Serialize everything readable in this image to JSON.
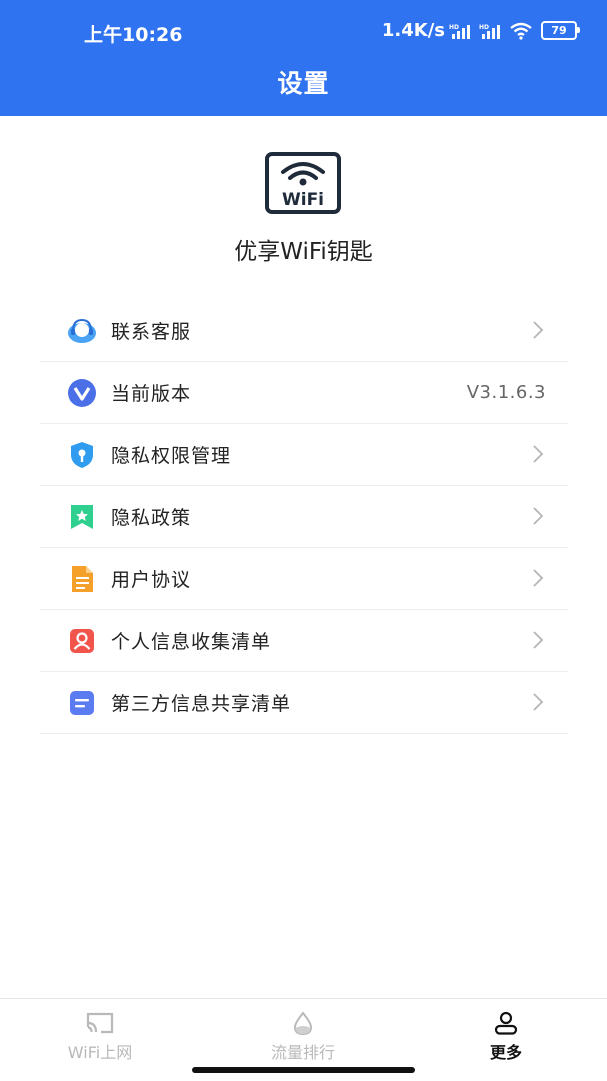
{
  "status_bar": {
    "time": "上午10:26",
    "network_speed": "1.4K/s",
    "battery": "79"
  },
  "header": {
    "title": "设置"
  },
  "app": {
    "name": "优享WiFi钥匙",
    "logo_text": "WiFi"
  },
  "menu": {
    "items": [
      {
        "label": "联系客服",
        "icon": "customer-service-icon",
        "color": "#4aa3f5"
      },
      {
        "label": "当前版本",
        "icon": "version-icon",
        "value": "V3.1.6.3",
        "color": "#4a6fe6"
      },
      {
        "label": "隐私权限管理",
        "icon": "shield-icon",
        "color": "#2f9cf0"
      },
      {
        "label": "隐私政策",
        "icon": "bookmark-icon",
        "color": "#2fcf8f"
      },
      {
        "label": "用户协议",
        "icon": "document-icon",
        "color": "#f5a02a"
      },
      {
        "label": "个人信息收集清单",
        "icon": "user-card-icon",
        "color": "#f0544a"
      },
      {
        "label": "第三方信息共享清单",
        "icon": "list-doc-icon",
        "color": "#5b7cf0"
      }
    ]
  },
  "tabbar": {
    "tabs": [
      {
        "label": "WiFi上网",
        "icon": "wifi-cast-icon"
      },
      {
        "label": "流量排行",
        "icon": "drop-icon"
      },
      {
        "label": "更多",
        "icon": "user-icon",
        "active": true
      }
    ]
  },
  "colors": {
    "primary": "#2f73f0"
  }
}
